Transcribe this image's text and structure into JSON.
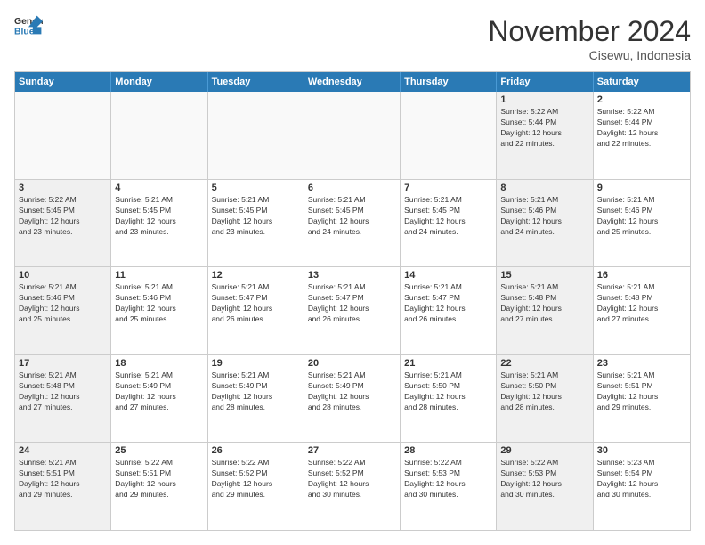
{
  "header": {
    "logo_line1": "General",
    "logo_line2": "Blue",
    "month_title": "November 2024",
    "location": "Cisewu, Indonesia"
  },
  "weekdays": [
    "Sunday",
    "Monday",
    "Tuesday",
    "Wednesday",
    "Thursday",
    "Friday",
    "Saturday"
  ],
  "rows": [
    [
      {
        "day": "",
        "info": "",
        "empty": true
      },
      {
        "day": "",
        "info": "",
        "empty": true
      },
      {
        "day": "",
        "info": "",
        "empty": true
      },
      {
        "day": "",
        "info": "",
        "empty": true
      },
      {
        "day": "",
        "info": "",
        "empty": true
      },
      {
        "day": "1",
        "info": "Sunrise: 5:22 AM\nSunset: 5:44 PM\nDaylight: 12 hours\nand 22 minutes.",
        "shaded": true
      },
      {
        "day": "2",
        "info": "Sunrise: 5:22 AM\nSunset: 5:44 PM\nDaylight: 12 hours\nand 22 minutes.",
        "shaded": false
      }
    ],
    [
      {
        "day": "3",
        "info": "Sunrise: 5:22 AM\nSunset: 5:45 PM\nDaylight: 12 hours\nand 23 minutes.",
        "shaded": true
      },
      {
        "day": "4",
        "info": "Sunrise: 5:21 AM\nSunset: 5:45 PM\nDaylight: 12 hours\nand 23 minutes.",
        "shaded": false
      },
      {
        "day": "5",
        "info": "Sunrise: 5:21 AM\nSunset: 5:45 PM\nDaylight: 12 hours\nand 23 minutes.",
        "shaded": false
      },
      {
        "day": "6",
        "info": "Sunrise: 5:21 AM\nSunset: 5:45 PM\nDaylight: 12 hours\nand 24 minutes.",
        "shaded": false
      },
      {
        "day": "7",
        "info": "Sunrise: 5:21 AM\nSunset: 5:45 PM\nDaylight: 12 hours\nand 24 minutes.",
        "shaded": false
      },
      {
        "day": "8",
        "info": "Sunrise: 5:21 AM\nSunset: 5:46 PM\nDaylight: 12 hours\nand 24 minutes.",
        "shaded": true
      },
      {
        "day": "9",
        "info": "Sunrise: 5:21 AM\nSunset: 5:46 PM\nDaylight: 12 hours\nand 25 minutes.",
        "shaded": false
      }
    ],
    [
      {
        "day": "10",
        "info": "Sunrise: 5:21 AM\nSunset: 5:46 PM\nDaylight: 12 hours\nand 25 minutes.",
        "shaded": true
      },
      {
        "day": "11",
        "info": "Sunrise: 5:21 AM\nSunset: 5:46 PM\nDaylight: 12 hours\nand 25 minutes.",
        "shaded": false
      },
      {
        "day": "12",
        "info": "Sunrise: 5:21 AM\nSunset: 5:47 PM\nDaylight: 12 hours\nand 26 minutes.",
        "shaded": false
      },
      {
        "day": "13",
        "info": "Sunrise: 5:21 AM\nSunset: 5:47 PM\nDaylight: 12 hours\nand 26 minutes.",
        "shaded": false
      },
      {
        "day": "14",
        "info": "Sunrise: 5:21 AM\nSunset: 5:47 PM\nDaylight: 12 hours\nand 26 minutes.",
        "shaded": false
      },
      {
        "day": "15",
        "info": "Sunrise: 5:21 AM\nSunset: 5:48 PM\nDaylight: 12 hours\nand 27 minutes.",
        "shaded": true
      },
      {
        "day": "16",
        "info": "Sunrise: 5:21 AM\nSunset: 5:48 PM\nDaylight: 12 hours\nand 27 minutes.",
        "shaded": false
      }
    ],
    [
      {
        "day": "17",
        "info": "Sunrise: 5:21 AM\nSunset: 5:48 PM\nDaylight: 12 hours\nand 27 minutes.",
        "shaded": true
      },
      {
        "day": "18",
        "info": "Sunrise: 5:21 AM\nSunset: 5:49 PM\nDaylight: 12 hours\nand 27 minutes.",
        "shaded": false
      },
      {
        "day": "19",
        "info": "Sunrise: 5:21 AM\nSunset: 5:49 PM\nDaylight: 12 hours\nand 28 minutes.",
        "shaded": false
      },
      {
        "day": "20",
        "info": "Sunrise: 5:21 AM\nSunset: 5:49 PM\nDaylight: 12 hours\nand 28 minutes.",
        "shaded": false
      },
      {
        "day": "21",
        "info": "Sunrise: 5:21 AM\nSunset: 5:50 PM\nDaylight: 12 hours\nand 28 minutes.",
        "shaded": false
      },
      {
        "day": "22",
        "info": "Sunrise: 5:21 AM\nSunset: 5:50 PM\nDaylight: 12 hours\nand 28 minutes.",
        "shaded": true
      },
      {
        "day": "23",
        "info": "Sunrise: 5:21 AM\nSunset: 5:51 PM\nDaylight: 12 hours\nand 29 minutes.",
        "shaded": false
      }
    ],
    [
      {
        "day": "24",
        "info": "Sunrise: 5:21 AM\nSunset: 5:51 PM\nDaylight: 12 hours\nand 29 minutes.",
        "shaded": true
      },
      {
        "day": "25",
        "info": "Sunrise: 5:22 AM\nSunset: 5:51 PM\nDaylight: 12 hours\nand 29 minutes.",
        "shaded": false
      },
      {
        "day": "26",
        "info": "Sunrise: 5:22 AM\nSunset: 5:52 PM\nDaylight: 12 hours\nand 29 minutes.",
        "shaded": false
      },
      {
        "day": "27",
        "info": "Sunrise: 5:22 AM\nSunset: 5:52 PM\nDaylight: 12 hours\nand 30 minutes.",
        "shaded": false
      },
      {
        "day": "28",
        "info": "Sunrise: 5:22 AM\nSunset: 5:53 PM\nDaylight: 12 hours\nand 30 minutes.",
        "shaded": false
      },
      {
        "day": "29",
        "info": "Sunrise: 5:22 AM\nSunset: 5:53 PM\nDaylight: 12 hours\nand 30 minutes.",
        "shaded": true
      },
      {
        "day": "30",
        "info": "Sunrise: 5:23 AM\nSunset: 5:54 PM\nDaylight: 12 hours\nand 30 minutes.",
        "shaded": false
      }
    ]
  ]
}
